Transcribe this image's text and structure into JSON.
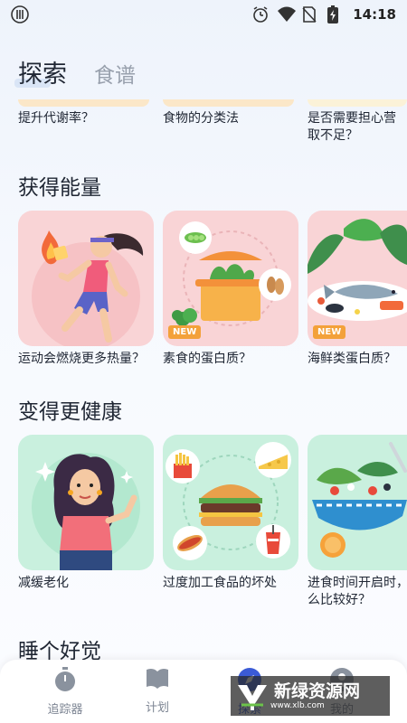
{
  "status_bar": {
    "time": "14:18",
    "left_icon": "utensils-icon",
    "right_icons": [
      "alarm-icon",
      "wifi-icon",
      "no-sim-icon",
      "battery-icon"
    ]
  },
  "tabs": {
    "explore": "探索",
    "recipes": "食谱"
  },
  "top_strip": {
    "items": [
      {
        "text": "提升代谢率？"
      },
      {
        "text": "食物的分类法"
      },
      {
        "text": "是否需要担心营养摄取不足？",
        "line1": "是否需要担心营",
        "line2": "取不足？"
      }
    ]
  },
  "sections": [
    {
      "title": "获得能量",
      "cards": [
        {
          "caption": "运动会燃烧更多热量？",
          "badge": ""
        },
        {
          "caption": "素食的蛋白质？",
          "badge": "NEW"
        },
        {
          "caption": "海鲜类蛋白质？",
          "badge": "NEW"
        }
      ]
    },
    {
      "title": "变得更健康",
      "cards": [
        {
          "caption": "减缓老化",
          "badge": ""
        },
        {
          "caption": "过度加工食品的坏处",
          "badge": ""
        },
        {
          "caption": "进食时间开启时，怎么比较好？",
          "line1": "进食时间开启时，",
          "line2": "么比较好？",
          "badge": ""
        }
      ]
    },
    {
      "title": "睡个好觉",
      "cards": []
    }
  ],
  "bottom_nav": {
    "items": [
      {
        "label": "追踪器",
        "icon": "stopwatch-icon"
      },
      {
        "label": "计划",
        "icon": "book-icon"
      },
      {
        "label": "探索",
        "icon": "compass-icon",
        "active": true
      },
      {
        "label": "我的",
        "icon": "profile-icon"
      }
    ]
  },
  "watermark": {
    "title": "新绿资源网",
    "url": "www.xlb.com"
  },
  "colors": {
    "accent": "#3b5bd6",
    "badge": "#f3a13a",
    "card_pink": "#f9d4d6",
    "card_green": "#c9f0de"
  }
}
